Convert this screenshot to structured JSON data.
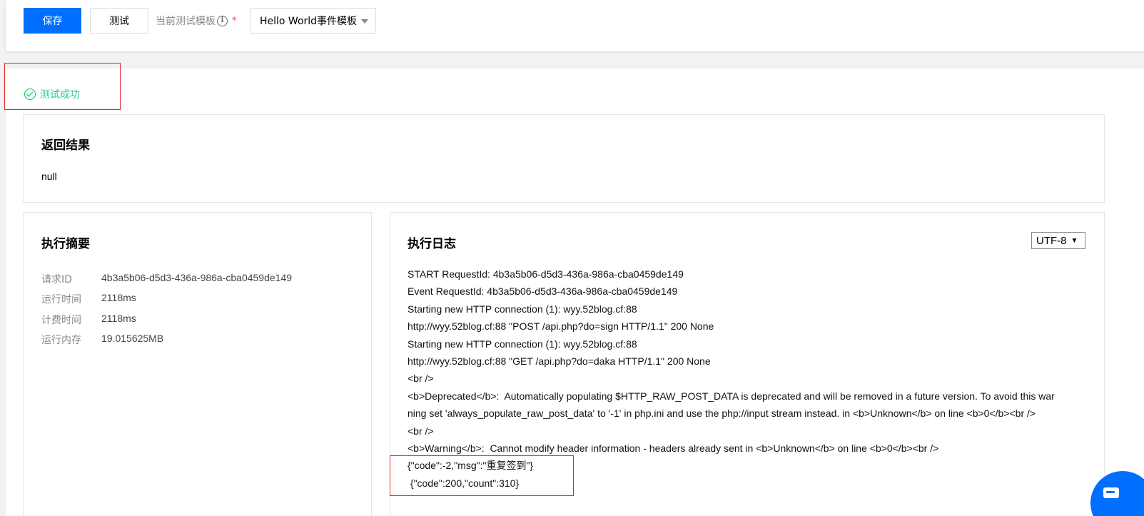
{
  "toolbar": {
    "save_label": "保存",
    "test_label": "测试",
    "template_label": "当前测试模板",
    "template_value": "Hello World事件模板"
  },
  "status": {
    "text": "测试成功",
    "color": "#29cc85"
  },
  "result": {
    "title": "返回结果",
    "value": "null"
  },
  "summary": {
    "title": "执行摘要",
    "rows": [
      {
        "key": "请求ID",
        "value": "4b3a5b06-d5d3-436a-986a-cba0459de149"
      },
      {
        "key": "运行时间",
        "value": "2118ms"
      },
      {
        "key": "计费时间",
        "value": "2118ms"
      },
      {
        "key": "运行内存",
        "value": "19.015625MB"
      }
    ]
  },
  "log": {
    "title": "执行日志",
    "encoding": "UTF-8",
    "lines": [
      "START RequestId: 4b3a5b06-d5d3-436a-986a-cba0459de149",
      "Event RequestId: 4b3a5b06-d5d3-436a-986a-cba0459de149",
      "Starting new HTTP connection (1): wyy.52blog.cf:88",
      "http://wyy.52blog.cf:88 \"POST /api.php?do=sign HTTP/1.1\" 200 None",
      "Starting new HTTP connection (1): wyy.52blog.cf:88",
      "http://wyy.52blog.cf:88 \"GET /api.php?do=daka HTTP/1.1\" 200 None",
      "<br />",
      "<b>Deprecated</b>:  Automatically populating $HTTP_RAW_POST_DATA is deprecated and will be removed in a future version. To avoid this war",
      "ning set 'always_populate_raw_post_data' to '-1' in php.ini and use the php://input stream instead. in <b>Unknown</b> on line <b>0</b><br />",
      "<br />",
      "<b>Warning</b>:  Cannot modify header information - headers already sent in <b>Unknown</b> on line <b>0</b><br />",
      "{\"code\":-2,\"msg\":\"重复签到\"}",
      " {\"code\":200,\"count\":310}"
    ]
  },
  "colors": {
    "primary": "#006eff",
    "success": "#0abf5b",
    "annotation": "#e3262a"
  }
}
